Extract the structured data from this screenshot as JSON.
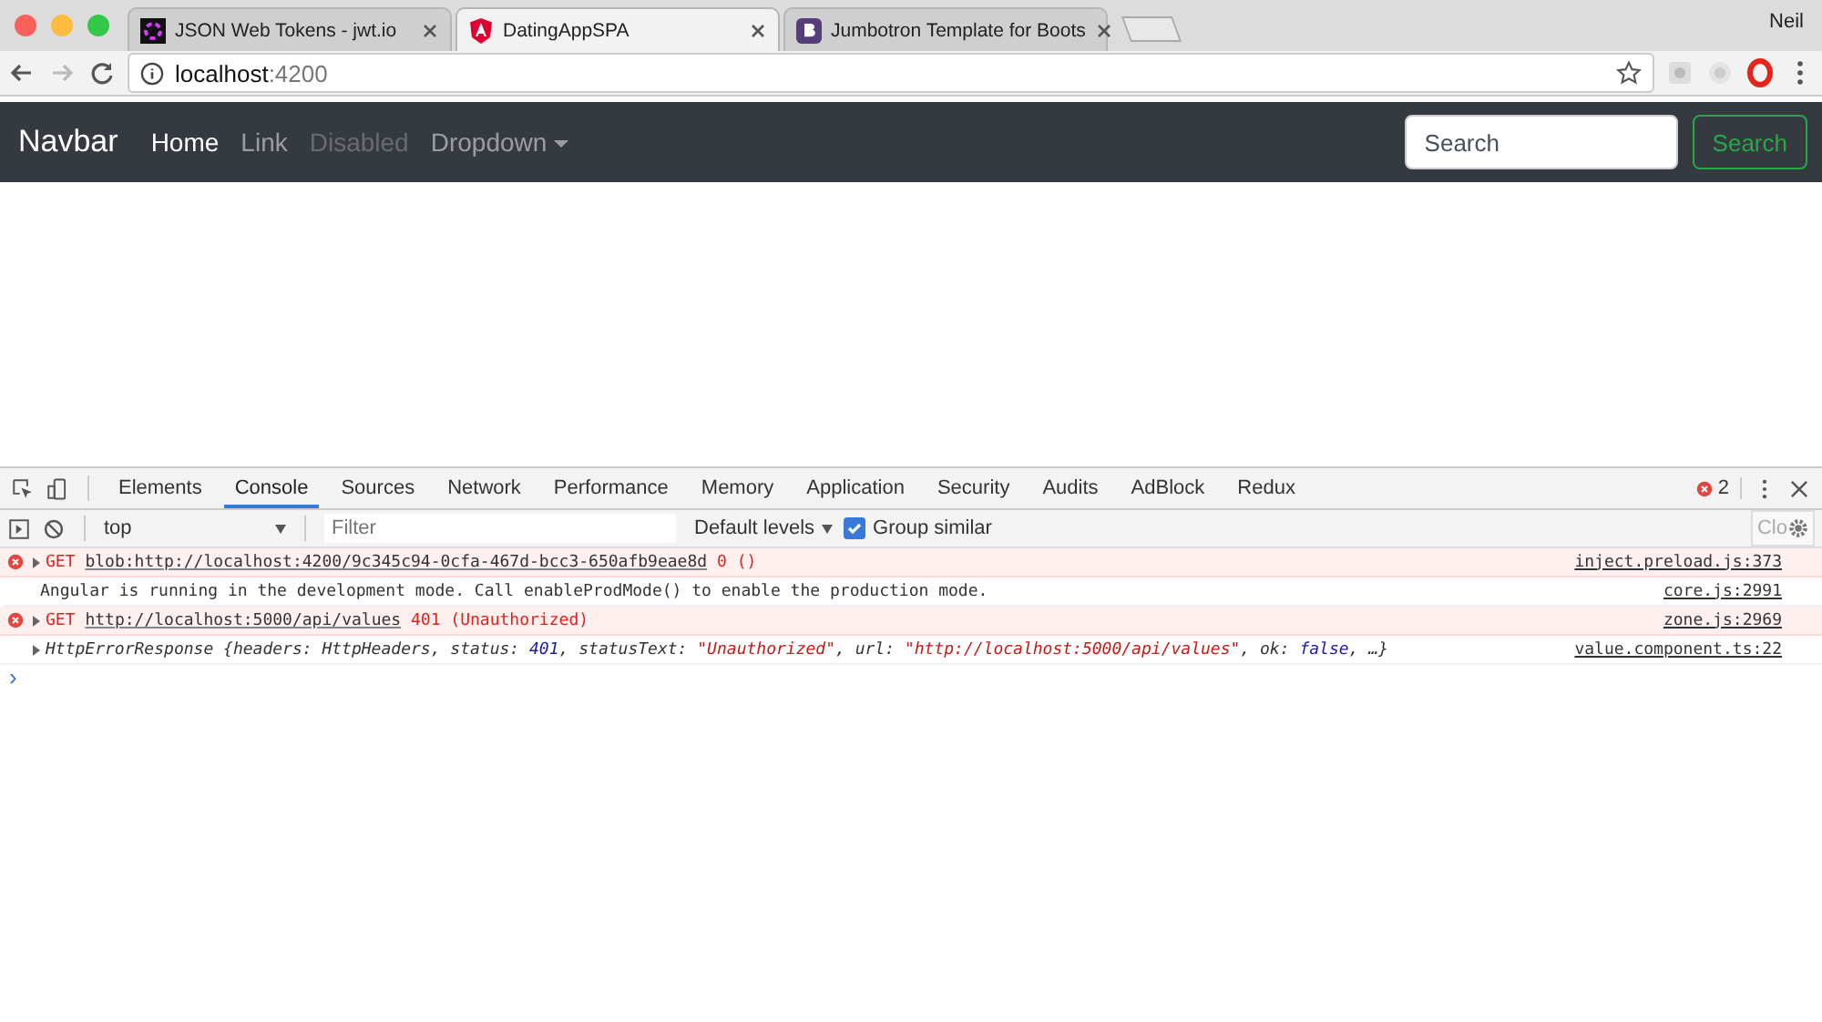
{
  "browser": {
    "tabs": [
      {
        "title": "JSON Web Tokens - jwt.io",
        "selected": false
      },
      {
        "title": "DatingAppSPA",
        "selected": true
      },
      {
        "title": "Jumbotron Template for Boots",
        "selected": false
      }
    ],
    "user": "Neil",
    "address": {
      "host": "localhost",
      "port": ":4200"
    }
  },
  "navbar": {
    "brand": "Navbar",
    "links": [
      {
        "label": "Home",
        "selected": true,
        "disabled": false
      },
      {
        "label": "Link",
        "selected": false,
        "disabled": false
      },
      {
        "label": "Disabled",
        "selected": false,
        "disabled": true
      },
      {
        "label": "Dropdown",
        "selected": false,
        "disabled": false,
        "dropdown": true
      }
    ],
    "search": {
      "placeholder": "Search"
    },
    "search_button": "Search"
  },
  "devtools": {
    "tabs": [
      {
        "label": "Elements",
        "selected": false
      },
      {
        "label": "Console",
        "selected": true
      },
      {
        "label": "Sources",
        "selected": false
      },
      {
        "label": "Network",
        "selected": false
      },
      {
        "label": "Performance",
        "selected": false
      },
      {
        "label": "Memory",
        "selected": false
      },
      {
        "label": "Application",
        "selected": false
      },
      {
        "label": "Security",
        "selected": false
      },
      {
        "label": "Audits",
        "selected": false
      },
      {
        "label": "AdBlock",
        "selected": false
      },
      {
        "label": "Redux",
        "selected": false
      }
    ],
    "error_count": "2",
    "context": "top",
    "filter": {
      "placeholder": "Filter"
    },
    "levels": "Default levels",
    "group_similar": {
      "label": "Group similar",
      "checked": true
    },
    "settings_label": "Clo",
    "messages": [
      {
        "kind": "error",
        "method": "GET",
        "url": "blob:http://localhost:4200/9c345c94-0cfa-467d-bcc3-650afb9eae8d",
        "status": "0 ()",
        "source": "inject.preload.js:373"
      },
      {
        "kind": "log",
        "text": "Angular is running in the development mode. Call enableProdMode() to enable the production mode.",
        "source": "core.js:2991"
      },
      {
        "kind": "error",
        "method": "GET",
        "url": "http://localhost:5000/api/values",
        "status": "401 (Unauthorized)",
        "source": "zone.js:2969"
      },
      {
        "kind": "object",
        "parts": [
          {
            "kind": "plain",
            "text": "HttpErrorResponse {headers: HttpHeaders, status: "
          },
          {
            "kind": "number",
            "text": "401"
          },
          {
            "kind": "plain",
            "text": ", statusText: "
          },
          {
            "kind": "string",
            "text": "\"Unauthorized\""
          },
          {
            "kind": "plain",
            "text": ", url: "
          },
          {
            "kind": "string",
            "text": "\"http://localhost:5000/api/values\""
          },
          {
            "kind": "plain",
            "text": ", ok: "
          },
          {
            "kind": "number",
            "text": "false"
          },
          {
            "kind": "plain",
            "text": ", …}"
          }
        ],
        "source": "value.component.ts:22"
      }
    ],
    "prompt": "›"
  }
}
